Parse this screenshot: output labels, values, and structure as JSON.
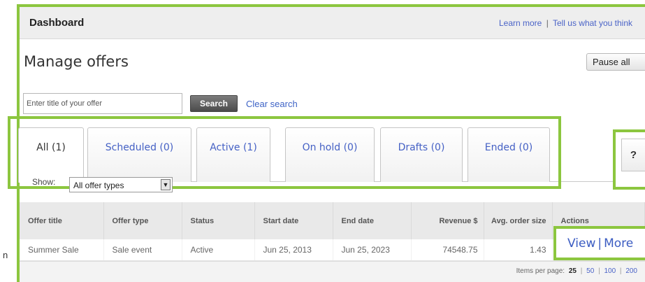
{
  "header": {
    "title": "Dashboard",
    "learn_more": "Learn more",
    "separator": "|",
    "feedback": "Tell us what you think"
  },
  "page": {
    "title": "Manage offers",
    "pause_all": "Pause all"
  },
  "search": {
    "placeholder": "Enter title of your offer",
    "button": "Search",
    "clear": "Clear search"
  },
  "tabs": [
    {
      "label": "All (1)",
      "active": true
    },
    {
      "label": "Scheduled (0)",
      "active": false
    },
    {
      "label": "Active (1)",
      "active": false
    },
    {
      "label": "On hold (0)",
      "active": false
    },
    {
      "label": "Drafts (0)",
      "active": false
    },
    {
      "label": "Ended (0)",
      "active": false
    }
  ],
  "help": "?",
  "filter": {
    "show_label": "Show:",
    "selected": "All offer types"
  },
  "table": {
    "columns": [
      "Offer title",
      "Offer type",
      "Status",
      "Start date",
      "End date",
      "Revenue $",
      "Avg. order size",
      "Actions"
    ],
    "rows": [
      [
        "Summer Sale",
        "Sale event",
        "Active",
        "Jun 25, 2013",
        "Jun 25, 2023",
        "74548.75",
        "1.43",
        ""
      ]
    ]
  },
  "row_actions": {
    "view": "View",
    "separator": "|",
    "more": "More"
  },
  "pagination": {
    "label": "Items per page:",
    "current": "25",
    "options": [
      "50",
      "100",
      "200"
    ]
  },
  "edge_letter": "n",
  "colors": {
    "highlight": "#8cc63f",
    "link": "#4a63c7"
  }
}
